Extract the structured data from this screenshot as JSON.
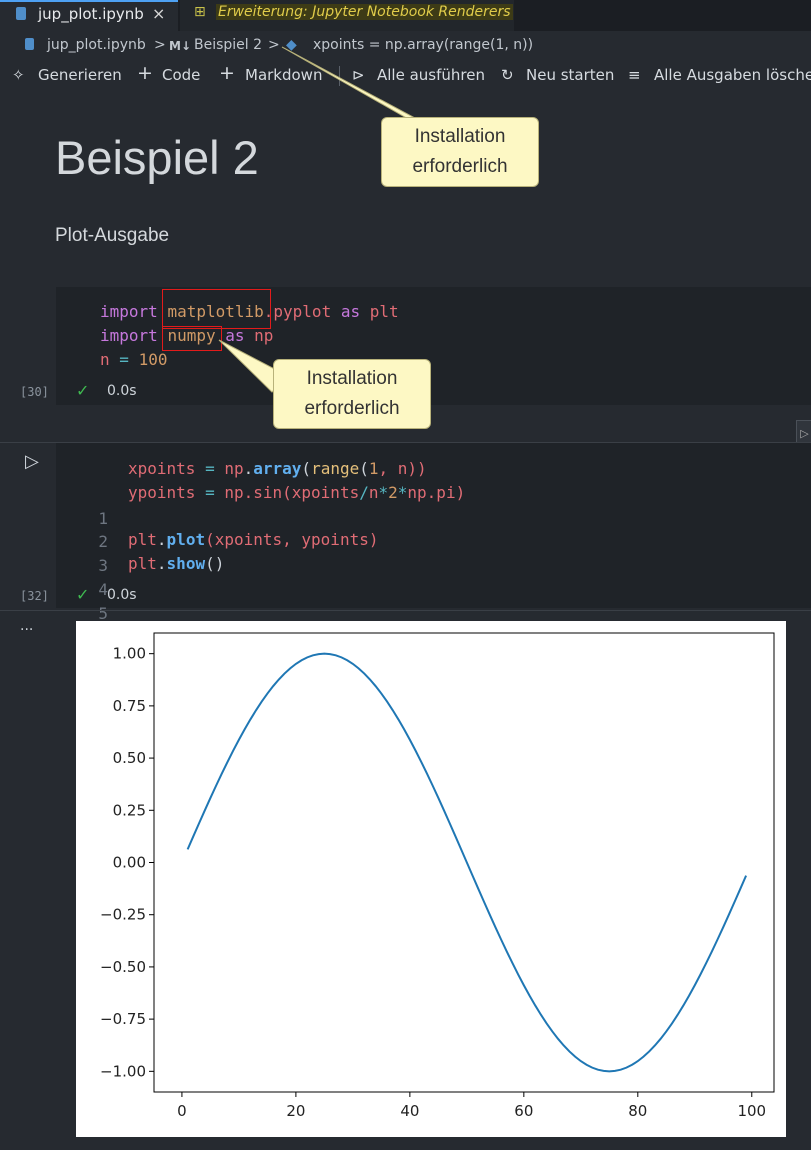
{
  "tabs": {
    "active": {
      "label": "jup_plot.ipynb",
      "close": "×"
    },
    "extension": {
      "label": "Erweiterung: Jupyter Notebook Renderers"
    }
  },
  "breadcrumb": {
    "file": "jup_plot.ipynb",
    "sep1": ">",
    "md_badge": "M↓",
    "section": "Beispiel 2",
    "sep2": ">",
    "cell": "xpoints = np.array(range(1, n))"
  },
  "toolbar": {
    "generate": "Generieren",
    "code": "Code",
    "markdown": "Markdown",
    "run_all": "Alle ausführen",
    "restart": "Neu starten",
    "clear_outputs": "Alle Ausgaben löscher"
  },
  "markdown": {
    "title": "Beispiel 2",
    "subtitle": "Plot-Ausgabe"
  },
  "cell1": {
    "exec_count": "[30]",
    "status": "✓",
    "duration": "0.0s",
    "line1": {
      "kw": "import",
      "mod1": "matplotlib",
      "mod2": ".pyplot",
      "as": "as",
      "alias": "plt"
    },
    "line2": {
      "kw": "import",
      "mod": "numpy",
      "as": "as",
      "alias": "np"
    },
    "line3": {
      "var": "n",
      "op": "=",
      "num": "100"
    }
  },
  "cell2": {
    "exec_count": "[32]",
    "status": "✓",
    "duration": "0.0s",
    "line_numbers": [
      "1",
      "2",
      "3",
      "4",
      "5"
    ],
    "line1": {
      "a": "xpoints",
      "b": " = ",
      "c": "np",
      "d": ".",
      "e": "array",
      "f": "(",
      "g": "range",
      "h": "(",
      "i": "1",
      "j": ", n))"
    },
    "line2": {
      "a": "ypoints",
      "b": " = ",
      "c": "np.sin(xpoints",
      "d": "/",
      "e": "n",
      "f": "*",
      "g": "2",
      "h": "*",
      "i": "np.pi)"
    },
    "line4": {
      "a": "plt",
      "b": ".",
      "c": "plot",
      "d": "(xpoints, ypoints)"
    },
    "line5": {
      "a": "plt",
      "b": ".",
      "c": "show",
      "d": "()"
    }
  },
  "output": {
    "more": "···"
  },
  "callouts": {
    "first": [
      "Installation",
      "erforderlich"
    ],
    "second": [
      "Installation",
      "erforderlich"
    ]
  },
  "chart_data": {
    "type": "line",
    "x_function": "range(1, 100)",
    "y_function": "sin(x / 100 * 2 * pi)",
    "xlim": [
      -4.9,
      103.9
    ],
    "ylim": [
      -1.099,
      1.099
    ],
    "xticks": [
      0,
      20,
      40,
      60,
      80,
      100
    ],
    "yticks": [
      1.0,
      0.75,
      0.5,
      0.25,
      0.0,
      -0.25,
      -0.5,
      -0.75,
      -1.0
    ],
    "xtick_labels": [
      "0",
      "20",
      "40",
      "60",
      "80",
      "100"
    ],
    "ytick_labels": [
      "1.00",
      "0.75",
      "0.50",
      "0.25",
      "0.00",
      "−0.25",
      "−0.50",
      "−0.75",
      "−1.00"
    ],
    "color": "#1f77b4"
  }
}
